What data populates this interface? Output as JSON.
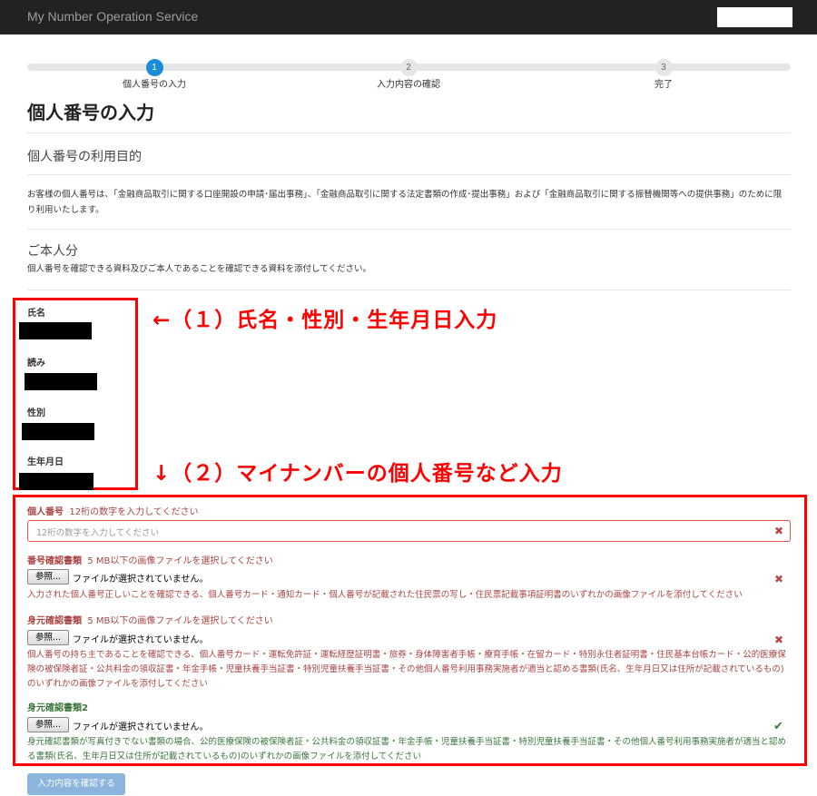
{
  "app": {
    "brand": "My Number Operation Service"
  },
  "steps": [
    {
      "num": "1",
      "label": "個人番号の入力"
    },
    {
      "num": "2",
      "label": "入力内容の確認"
    },
    {
      "num": "3",
      "label": "完了"
    }
  ],
  "page_title": "個人番号の入力",
  "purpose": {
    "title": "個人番号の利用目的",
    "text": "お客様の個人番号は、「金融商品取引に関する口座開設の申請･届出事務」、「金融商品取引に関する法定書類の作成･提出事務」および「金融商品取引に関する振替機関等への提供事務」のために限り利用いたします。"
  },
  "self": {
    "title": "ご本人分",
    "text": "個人番号を確認できる資料及びご本人であることを確認できる資料を添付してください。"
  },
  "personal": {
    "name_label": "氏名",
    "reading_label": "読み",
    "gender_label": "性別",
    "birth_label": "生年月日"
  },
  "annotations": {
    "a1": "←（１）氏名・性別・生年月日入力",
    "a2": "↓（２）マイナンバーの個人番号など入力"
  },
  "form": {
    "number_label": "個人番号",
    "number_error": "12桁の数字を入力してください",
    "number_placeholder": "12桁の数字を入力してください",
    "doc1_label": "番号確認書類",
    "doc1_error": "5 MB以下の画像ファイルを選択してください",
    "doc1_help": "入力された個人番号正しいことを確認できる、個人番号カード・通知カード・個人番号が記載された住民票の写し・住民票記載事項証明書のいずれかの画像ファイルを添付してください",
    "doc2_label": "身元確認書類",
    "doc2_error": "5 MB以下の画像ファイルを選択してください",
    "doc2_help": "個人番号の持ち主であることを確認できる、個人番号カード・運転免許証・運転経歴証明書・旅券・身体障害者手帳・療育手帳・在留カード・特別永住者証明書・住民基本台帳カード・公的医療保険の被保険者証・公共料金の領収証書・年金手帳・児童扶養手当証書・特別児童扶養手当証書・その他個人番号利用事務実施者が適当と認める書類(氏名、生年月日又は住所が記載されているもの)のいずれかの画像ファイルを添付してください",
    "doc3_label": "身元確認書類2",
    "doc3_help": "身元確認書類が写真付きでない書類の場合、公的医療保険の被保険者証・公共料金の領収証書・年金手帳・児童扶養手当証書・特別児童扶養手当証書・その他個人番号利用事務実施者が適当と認める書類(氏名、生年月日又は住所が記載されているもの)のいずれかの画像ファイルを添付してください",
    "browse_label": "参照...",
    "no_file": "ファイルが選択されていません。"
  },
  "submit_label": "入力内容を確認する",
  "colors": {
    "accent": "#1a8cd8",
    "error": "#a94442",
    "success": "#3c763d",
    "annotation": "#ff0000"
  },
  "icons": {
    "error": "times-icon",
    "success": "check-icon"
  }
}
